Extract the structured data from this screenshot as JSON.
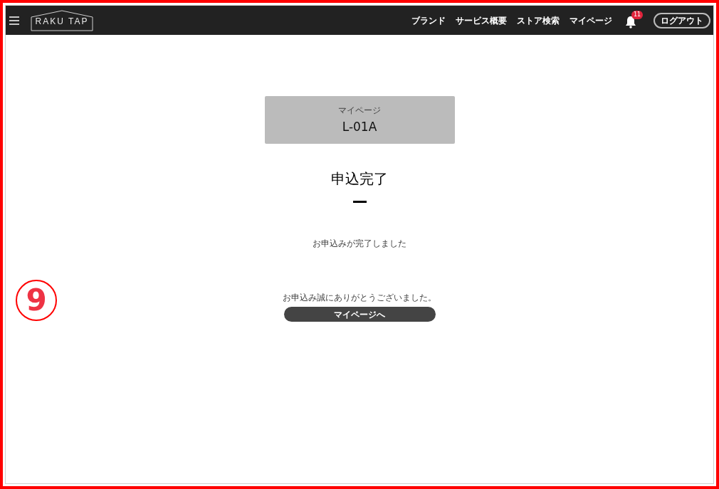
{
  "header": {
    "logo": "RAKU TAP",
    "nav": [
      "ブランド",
      "サービス概要",
      "ストア検索",
      "マイページ"
    ],
    "notification_count": "11",
    "logout": "ログアウト"
  },
  "page_banner": {
    "label": "マイページ",
    "code": "L-01A"
  },
  "title": "申込完了",
  "message": "お申込みが完了しました",
  "thanks": "お申込み誠にありがとうございました。",
  "button": "マイページへ",
  "annotation": "9"
}
